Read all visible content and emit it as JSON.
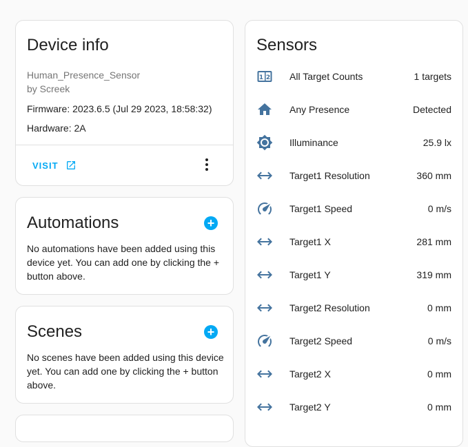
{
  "device_info": {
    "title": "Device info",
    "model": "Human_Presence_Sensor",
    "manufacturer": "by Screek",
    "firmware": "Firmware: 2023.6.5 (Jul 29 2023, 18:58:32)",
    "hardware": "Hardware: 2A",
    "visit_label": "VISIT"
  },
  "automations": {
    "title": "Automations",
    "message": "No automations have been added using this device yet. You can add one by clicking the + button above."
  },
  "scenes": {
    "title": "Scenes",
    "message": "No scenes have been added using this device yet. You can add one by clicking the + button above."
  },
  "sensors": {
    "title": "Sensors",
    "items": [
      {
        "icon": "counter-icon",
        "name": "All Target Counts",
        "value": "1 targets"
      },
      {
        "icon": "home-icon",
        "name": "Any Presence",
        "value": "Detected"
      },
      {
        "icon": "brightness-icon",
        "name": "Illuminance",
        "value": "25.9 lx"
      },
      {
        "icon": "arrow-left-right-icon",
        "name": "Target1 Resolution",
        "value": "360 mm"
      },
      {
        "icon": "speedometer-icon",
        "name": "Target1 Speed",
        "value": "0 m/s"
      },
      {
        "icon": "arrow-left-right-icon",
        "name": "Target1 X",
        "value": "281 mm"
      },
      {
        "icon": "arrow-left-right-icon",
        "name": "Target1 Y",
        "value": "319 mm"
      },
      {
        "icon": "arrow-left-right-icon",
        "name": "Target2 Resolution",
        "value": "0 mm"
      },
      {
        "icon": "speedometer-icon",
        "name": "Target2 Speed",
        "value": "0 m/s"
      },
      {
        "icon": "arrow-left-right-icon",
        "name": "Target2 X",
        "value": "0 mm"
      },
      {
        "icon": "arrow-left-right-icon",
        "name": "Target2 Y",
        "value": "0 mm"
      }
    ]
  },
  "colors": {
    "accent": "#03a9f4",
    "icon": "#44739e",
    "card_border": "#e0e0e0",
    "background": "#fafafa"
  }
}
